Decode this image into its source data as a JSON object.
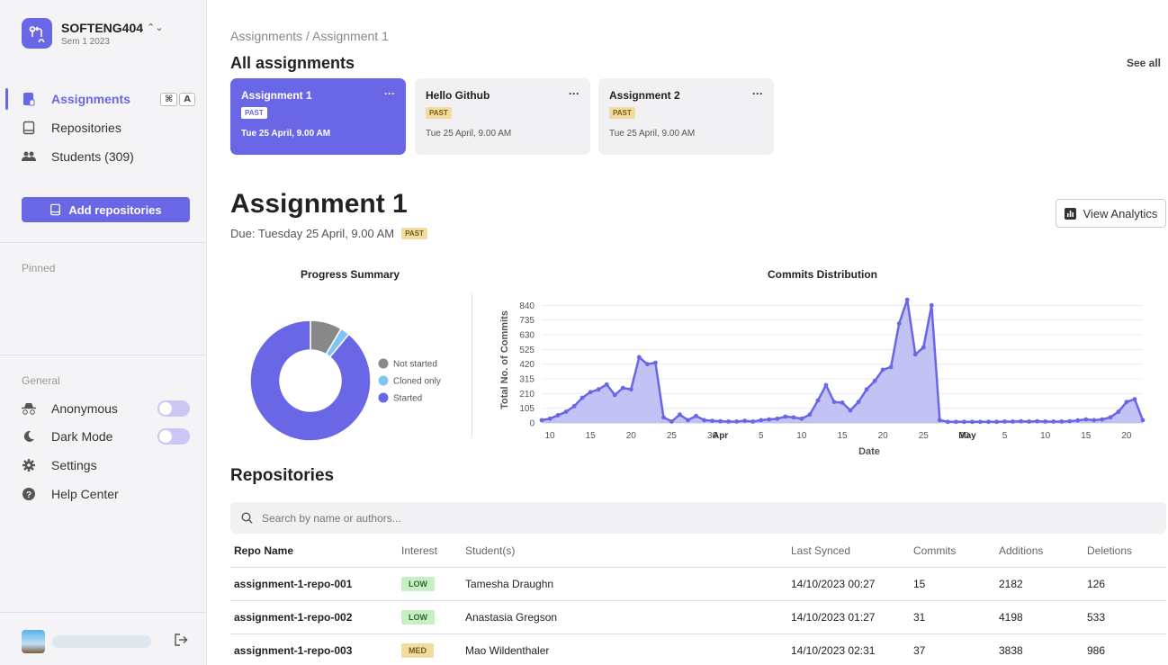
{
  "team": {
    "name": "SOFTENG404",
    "semester": "Sem 1 2023"
  },
  "nav": [
    {
      "label": "Assignments",
      "icon": "assignments-icon",
      "active": true,
      "shortcut": [
        "⌘",
        "A"
      ]
    },
    {
      "label": "Repositories",
      "icon": "repositories-icon",
      "active": false
    },
    {
      "label": "Students (309)",
      "icon": "students-icon",
      "active": false
    }
  ],
  "add_repositories_label": "Add repositories",
  "pinned_label": "Pinned",
  "general_label": "General",
  "general": [
    {
      "label": "Anonymous",
      "icon": "anonymous-icon",
      "toggle": true
    },
    {
      "label": "Dark Mode",
      "icon": "moon-icon",
      "toggle": true
    },
    {
      "label": "Settings",
      "icon": "gear-icon"
    },
    {
      "label": "Help Center",
      "icon": "help-icon"
    }
  ],
  "breadcrumb": "Assignments / Assignment 1",
  "all_assignments_title": "All assignments",
  "see_all_label": "See all",
  "assignment_cards": [
    {
      "title": "Assignment 1",
      "badge": "PAST",
      "date": "Tue 25 April, 9.00 AM",
      "selected": true
    },
    {
      "title": "Hello Github",
      "badge": "PAST",
      "date": "Tue 25 April, 9.00 AM",
      "selected": false
    },
    {
      "title": "Assignment 2",
      "badge": "PAST",
      "date": "Tue 25 April, 9.00 AM",
      "selected": false
    }
  ],
  "card_menu_label": "···",
  "assignment": {
    "title": "Assignment 1",
    "due": "Due: Tuesday 25 April, 9.00 AM",
    "badge": "PAST"
  },
  "view_analytics_label": "View Analytics",
  "progress_title": "Progress Summary",
  "commits_title": "Commits Distribution",
  "repositories_title": "Repositories",
  "search": {
    "placeholder": "Search by name or authors..."
  },
  "table": {
    "headers": [
      "Repo Name",
      "Interest",
      "Student(s)",
      "Last Synced",
      "Commits",
      "Additions",
      "Deletions"
    ],
    "rows": [
      {
        "repo": "assignment-1-repo-001",
        "interest": "LOW",
        "student": "Tamesha Draughn",
        "synced": "14/10/2023 00:27",
        "commits": "15",
        "additions": "2182",
        "deletions": "126"
      },
      {
        "repo": "assignment-1-repo-002",
        "interest": "LOW",
        "student": "Anastasia Gregson",
        "synced": "14/10/2023 01:27",
        "commits": "31",
        "additions": "4198",
        "deletions": "533"
      },
      {
        "repo": "assignment-1-repo-003",
        "interest": "MED",
        "student": "Mao Wildenthaler",
        "synced": "14/10/2023 02:31",
        "commits": "37",
        "additions": "3838",
        "deletions": "986"
      }
    ]
  },
  "colors": {
    "accent": "#6a67e6",
    "not_started": "#888888",
    "cloned_only": "#7fc4f2",
    "started": "#6a67e6",
    "line_fill": "#b9b7f3"
  },
  "chart_data": [
    {
      "type": "pie",
      "title": "Progress Summary",
      "categories": [
        "Not started",
        "Cloned only",
        "Started"
      ],
      "values": [
        8.5,
        2.5,
        89
      ],
      "legend": "right"
    },
    {
      "type": "area",
      "title": "Commits Distribution",
      "xlabel": "Date",
      "ylabel": "Total No. of Commits",
      "ylim": [
        0,
        900
      ],
      "yticks": [
        0,
        105,
        210,
        315,
        420,
        525,
        630,
        735,
        840
      ],
      "xticks": [
        {
          "label": "10",
          "day": 1
        },
        {
          "label": "15",
          "day": 6
        },
        {
          "label": "20",
          "day": 11
        },
        {
          "label": "25",
          "day": 16
        },
        {
          "label": "30",
          "day": 21
        },
        {
          "label": "Apr",
          "day": 22
        },
        {
          "label": "5",
          "day": 27
        },
        {
          "label": "10",
          "day": 32
        },
        {
          "label": "15",
          "day": 37
        },
        {
          "label": "20",
          "day": 42
        },
        {
          "label": "25",
          "day": 47
        },
        {
          "label": "30",
          "day": 52
        },
        {
          "label": "May",
          "day": 52.4
        },
        {
          "label": "5",
          "day": 57
        },
        {
          "label": "10",
          "day": 62
        },
        {
          "label": "15",
          "day": 67
        },
        {
          "label": "20",
          "day": 72
        }
      ],
      "grid": true,
      "series": [
        {
          "values": [
            20,
            30,
            55,
            80,
            120,
            180,
            220,
            240,
            275,
            200,
            250,
            240,
            470,
            420,
            430,
            40,
            10,
            60,
            20,
            50,
            20,
            15,
            12,
            10,
            10,
            15,
            10,
            20,
            25,
            30,
            45,
            40,
            30,
            60,
            160,
            270,
            150,
            145,
            90,
            150,
            240,
            300,
            380,
            400,
            710,
            880,
            490,
            540,
            840,
            20,
            8,
            8,
            8,
            8,
            8,
            8,
            8,
            10,
            10,
            12,
            10,
            12,
            10,
            10,
            10,
            12,
            18,
            25,
            20,
            25,
            40,
            80,
            150,
            170,
            20
          ]
        }
      ]
    }
  ]
}
